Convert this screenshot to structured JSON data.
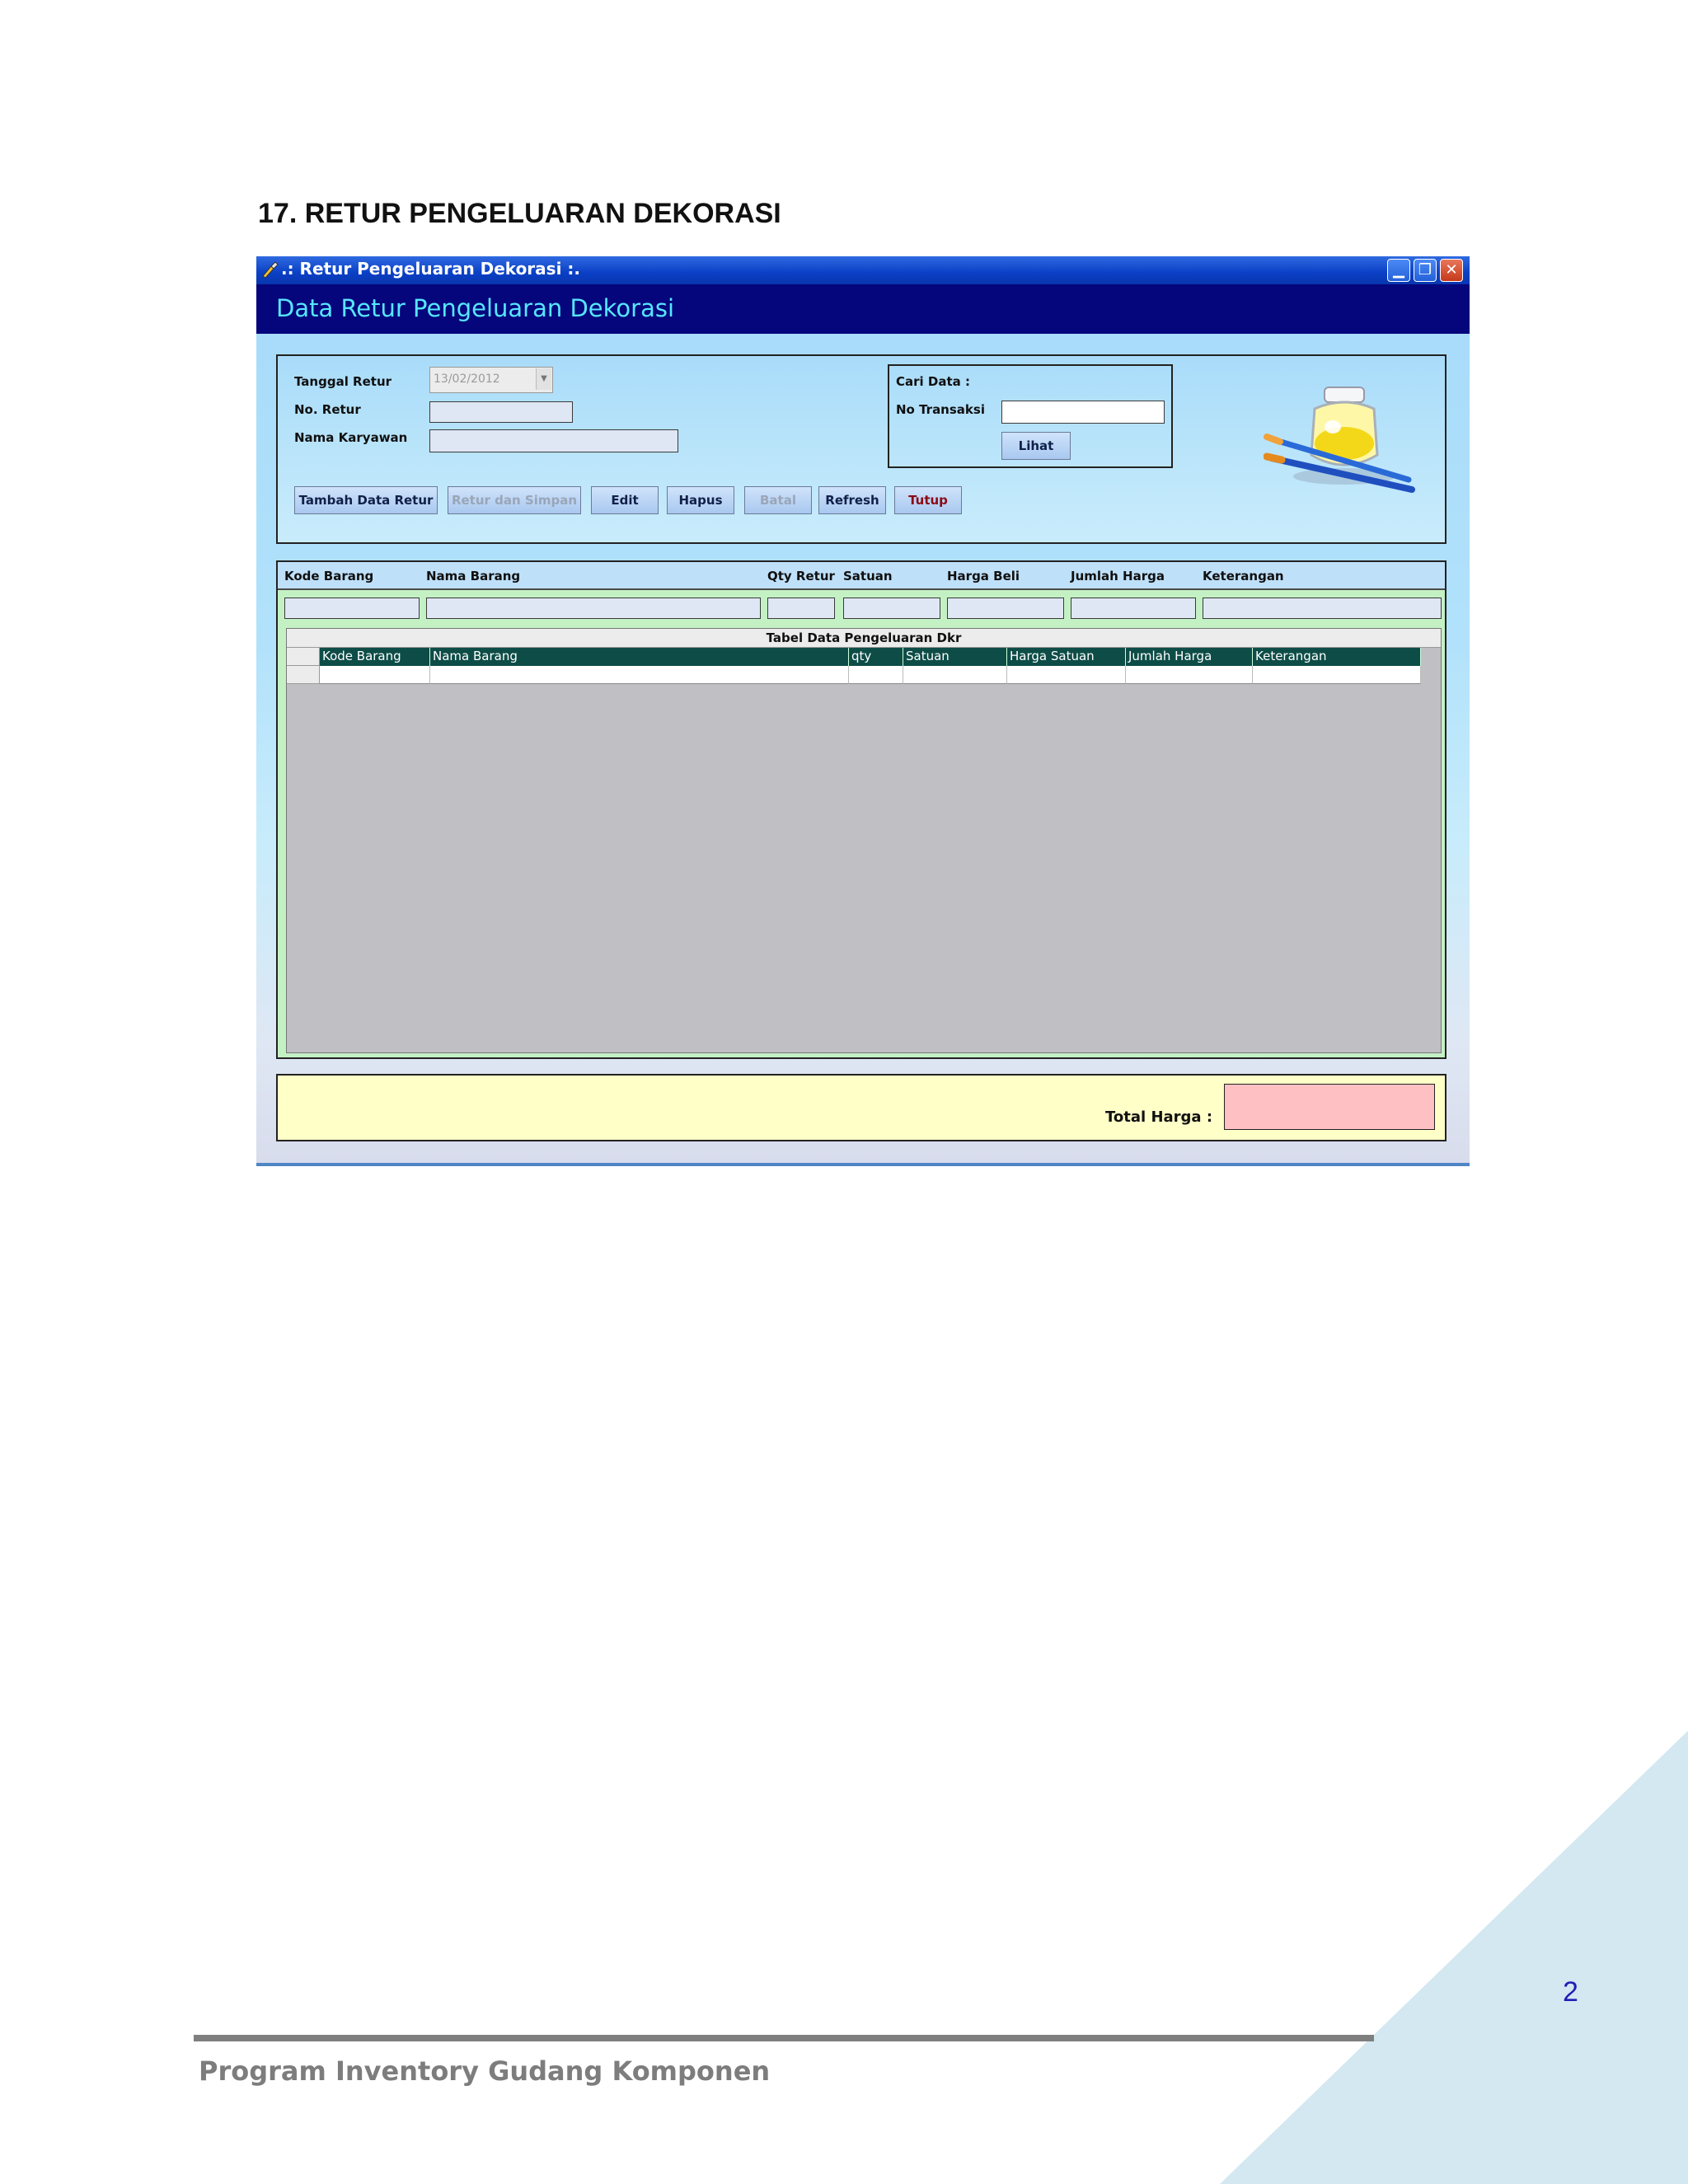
{
  "document": {
    "section_title": "17. RETUR PENGELUARAN DEKORASI",
    "page_number": "2",
    "footer_text": "Program Inventory Gudang Komponen"
  },
  "window": {
    "title": ".: Retur Pengeluaran Dekorasi :.",
    "header": "Data Retur Pengeluaran Dekorasi",
    "minimize": "▁",
    "restore": "❐",
    "close": "✕"
  },
  "form": {
    "tanggal_retur_label": "Tanggal Retur",
    "tanggal_retur_value": "13/02/2012",
    "no_retur_label": "No. Retur",
    "no_retur_value": "",
    "nama_karyawan_label": "Nama Karyawan",
    "nama_karyawan_value": ""
  },
  "search": {
    "caption": "Cari Data :",
    "no_transaksi_label": "No Transaksi",
    "no_transaksi_value": "",
    "lihat_label": "Lihat"
  },
  "toolbar": {
    "tambah": "Tambah Data Retur",
    "retur_simpan": "Retur dan Simpan",
    "edit": "Edit",
    "hapus": "Hapus",
    "batal": "Batal",
    "refresh": "Refresh",
    "tutup": "Tutup"
  },
  "detail": {
    "columns": [
      "Kode Barang",
      "Nama Barang",
      "Qty Retur",
      "Satuan",
      "Harga Beli",
      "Jumlah Harga",
      "Keterangan"
    ]
  },
  "grid": {
    "caption": "Tabel Data Pengeluaran Dkr",
    "columns": [
      "Kode Barang",
      "Nama Barang",
      "qty",
      "Satuan",
      "Harga Satuan",
      "Jumlah Harga",
      "Keterangan"
    ]
  },
  "summary": {
    "total_label": "Total Harga :",
    "total_value": ""
  },
  "colors": {
    "title_bar": "#0a3fc6",
    "header_band": "#06067c",
    "header_text": "#56e6ff",
    "grid_header": "#0e4d47",
    "total_box": "#ffc0c4",
    "footer_triangle": "#d3e8f1"
  },
  "icons": {
    "app_icon": "paintbrush-icon",
    "decoration": "paint-jar-brushes-icon"
  }
}
